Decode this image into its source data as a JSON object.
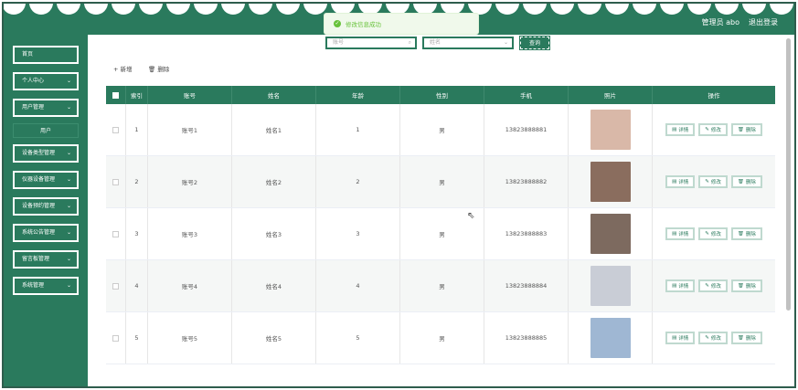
{
  "header": {
    "user_label": "管理员 abo",
    "logout_label": "退出登录",
    "bg_color": "#2a7a5d"
  },
  "toast": {
    "icon": "check-circle-icon",
    "text": "修改信息成功"
  },
  "sidebar": {
    "items": [
      {
        "label": "首页",
        "has_chevron": false
      },
      {
        "label": "个人中心",
        "has_chevron": true
      },
      {
        "label": "用户管理",
        "has_chevron": true
      },
      {
        "label": "设备类型管理",
        "has_chevron": true
      },
      {
        "label": "仪器设备管理",
        "has_chevron": true
      },
      {
        "label": "设备预约管理",
        "has_chevron": true
      },
      {
        "label": "系统公告管理",
        "has_chevron": true
      },
      {
        "label": "留言板管理",
        "has_chevron": true
      },
      {
        "label": "系统管理",
        "has_chevron": true
      }
    ],
    "sub_item_label": "用户"
  },
  "search": {
    "account_placeholder": "账号",
    "name_placeholder": "姓名",
    "query_label": "查询"
  },
  "actions": {
    "add_label": "+ 新增",
    "delete_label": "删除"
  },
  "table": {
    "headers": [
      "索引",
      "账号",
      "姓名",
      "年龄",
      "性别",
      "手机",
      "照片",
      "操作"
    ],
    "rows": [
      {
        "index": "1",
        "account": "账号1",
        "name": "姓名1",
        "age": "1",
        "gender": "男",
        "phone": "13823888881",
        "photo_color": "#d9b8a8"
      },
      {
        "index": "2",
        "account": "账号2",
        "name": "姓名2",
        "age": "2",
        "gender": "男",
        "phone": "13823888882",
        "photo_color": "#8a6d5e"
      },
      {
        "index": "3",
        "account": "账号3",
        "name": "姓名3",
        "age": "3",
        "gender": "男",
        "phone": "13823888883",
        "photo_color": "#7d6a5f"
      },
      {
        "index": "4",
        "account": "账号4",
        "name": "姓名4",
        "age": "4",
        "gender": "男",
        "phone": "13823888884",
        "photo_color": "#c9cdd6"
      },
      {
        "index": "5",
        "account": "账号5",
        "name": "姓名5",
        "age": "5",
        "gender": "男",
        "phone": "13823888885",
        "photo_color": "#9fb7d3"
      }
    ],
    "row_buttons": {
      "detail": "详情",
      "edit": "修改",
      "delete": "删除"
    }
  }
}
